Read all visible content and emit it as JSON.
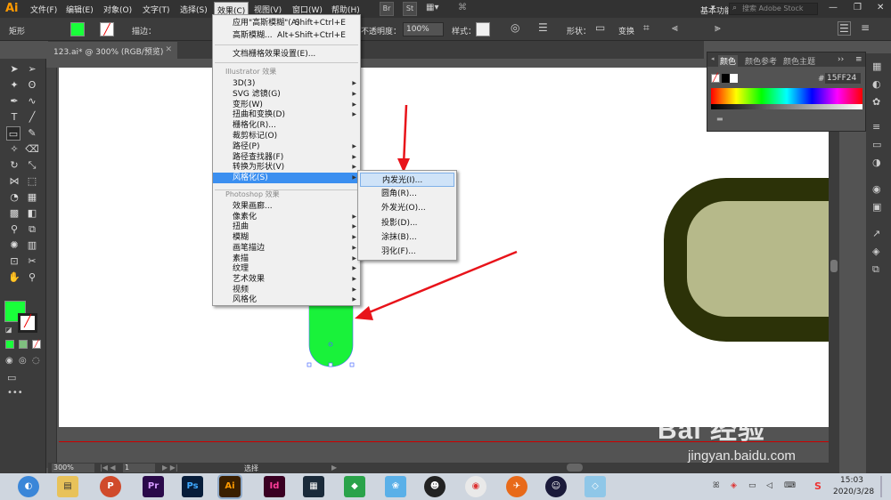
{
  "app": {
    "logo": "Ai"
  },
  "menubar": {
    "items": [
      "文件(F)",
      "编辑(E)",
      "对象(O)",
      "文字(T)",
      "选择(S)",
      "效果(C)",
      "视图(V)",
      "窗口(W)",
      "帮助(H)"
    ],
    "bridge": "Br",
    "stock": "St",
    "workspace": "基本功能",
    "search_placeholder": "搜索 Adobe Stock"
  },
  "controlbar": {
    "shape_label": "矩形",
    "stroke_label": "描边：",
    "opacity_label": "不透明度：",
    "opacity_value": "100%",
    "style_label": "样式：",
    "shape_menu": "形状：",
    "transform": "变换",
    "fill_color": "#19ff3a"
  },
  "document": {
    "tab_title": "123.ai* @ 300% (RGB/预览)"
  },
  "effect_menu": {
    "apply_last": "应用\"高斯模糊\"(A)",
    "apply_last_shortcut": "Shift+Ctrl+E",
    "last_effect": "高斯模糊...",
    "last_effect_shortcut": "Alt+Shift+Ctrl+E",
    "raster_settings": "文档栅格效果设置(E)...",
    "illustrator_header": "Illustrator 效果",
    "illustrator_items": [
      "3D(3)",
      "SVG 滤镜(G)",
      "变形(W)",
      "扭曲和变换(D)",
      "栅格化(R)...",
      "裁剪标记(O)",
      "路径(P)",
      "路径查找器(F)",
      "转换为形状(V)",
      "风格化(S)"
    ],
    "illustrator_has_submenu": [
      true,
      true,
      true,
      true,
      false,
      false,
      true,
      true,
      true,
      true
    ],
    "photoshop_header": "Photoshop 效果",
    "photoshop_items": [
      "效果画廊...",
      "像素化",
      "扭曲",
      "模糊",
      "画笔描边",
      "素描",
      "纹理",
      "艺术效果",
      "视频",
      "风格化"
    ],
    "photoshop_has_submenu": [
      false,
      true,
      true,
      true,
      true,
      true,
      true,
      true,
      true,
      true
    ]
  },
  "stylize_submenu": {
    "items": [
      "内发光(I)...",
      "圆角(R)...",
      "外发光(O)...",
      "投影(D)...",
      "涂抹(B)...",
      "羽化(F)..."
    ]
  },
  "color_panel": {
    "tabs": [
      "颜色",
      "颜色参考",
      "颜色主题"
    ],
    "hex_label": "#",
    "hex_value": "15FF24"
  },
  "canvas": {
    "green_shape_color": "#19f23a",
    "dark_frame_color": "#2c3208",
    "inner_fill_color": "#b6b98a",
    "arrow_color": "#e8131a"
  },
  "statusbar": {
    "zoom": "300%",
    "page": "1",
    "tool": "选择"
  },
  "taskbar": {
    "time": "15:03",
    "date": "2020/3/28"
  },
  "watermark": {
    "brand": "Bai 经验",
    "url": "jingyan.baidu.com"
  }
}
